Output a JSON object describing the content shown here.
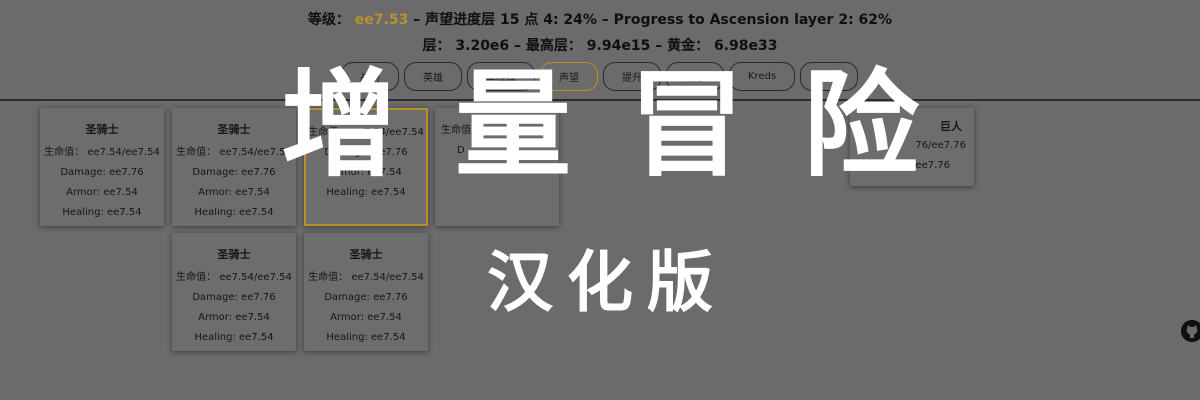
{
  "stats": {
    "level_label": "等级：",
    "level_value": "ee7.53",
    "prestige_text": "– 声望进度层 15 点 4: 24% – Progress to Ascension layer 2: 62%",
    "layer_label": "层：",
    "layer_value": "3.20e6",
    "highest_label": "– 最高层：",
    "highest_value": "9.94e15",
    "gold_label": "– 黄金：",
    "gold_value": "6.98e33"
  },
  "tabs": [
    {
      "label": "战场"
    },
    {
      "label": "英雄"
    },
    {
      "label": "军械库"
    },
    {
      "label": "声望"
    },
    {
      "label": "提升"
    },
    {
      "label": "信息"
    },
    {
      "label": "Kreds"
    },
    {
      "label": "选项"
    }
  ],
  "active_tab": "声望",
  "cards": [
    {
      "name": "圣骑士",
      "hp": "生命值： ee7.54/ee7.54",
      "damage": "Damage: ee7.76",
      "armor": "Armor: ee7.54",
      "healing": "Healing: ee7.54"
    },
    {
      "name": "圣骑士",
      "hp": "生命值： ee7.54/ee7.54",
      "damage": "Damage: ee7.76",
      "armor": "Armor: ee7.54",
      "healing": "Healing: ee7.54"
    },
    {
      "name": "",
      "hp": "生命值： ee7.54/ee7.54",
      "damage": "Damage: ee7.76",
      "armor": "Armor: ee7.54",
      "healing": "Healing: ee7.54"
    },
    {
      "name": "",
      "hp": "生命值",
      "damage": "D",
      "armor": "",
      "healing": ""
    },
    {
      "name": "圣骑士",
      "hp": "生命值： ee7.54/ee7.54",
      "damage": "Damage: ee7.76",
      "armor": "Armor: ee7.54",
      "healing": "Healing: ee7.54"
    },
    {
      "name": "圣骑士",
      "hp": "生命值： ee7.54/ee7.54",
      "damage": "Damage: ee7.76",
      "armor": "Armor: ee7.54",
      "healing": "Healing: ee7.54"
    },
    {
      "name": "巨人",
      "hp": "76/ee7.76",
      "damage": "Damage: ee7.76",
      "armor": "",
      "healing": ""
    }
  ],
  "overlay": {
    "title": "增量冒险",
    "subtitle": "汉化版"
  },
  "colors": {
    "background": "#6b6b6b",
    "accent_gold": "#b8922e",
    "overlay_text": "#ffffff"
  }
}
